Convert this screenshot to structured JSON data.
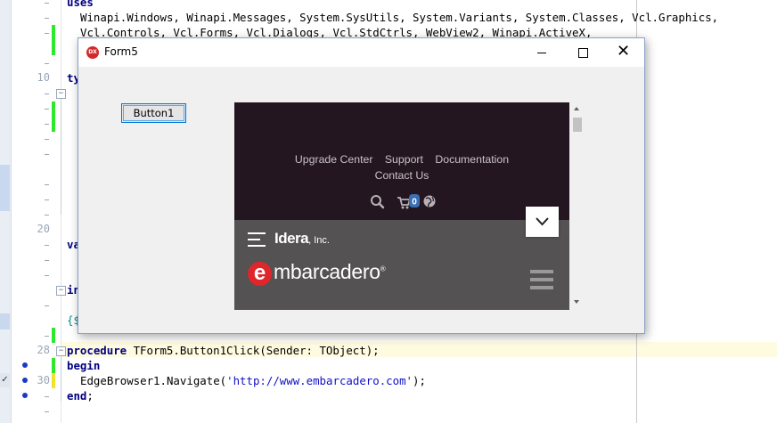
{
  "editor": {
    "line_numbers": [
      {
        "n": "10",
        "row": 5
      },
      {
        "n": "20",
        "row": 15
      },
      {
        "n": "28",
        "row": 23
      },
      {
        "n": "30",
        "row": 25
      }
    ],
    "lines": [
      {
        "row": 0,
        "indent": 0,
        "parts": [
          {
            "t": "uses",
            "c": "kw"
          }
        ]
      },
      {
        "row": 1,
        "indent": 2,
        "parts": [
          {
            "t": "Winapi.Windows, Winapi.Messages, System.SysUtils, System.Variants, System.Classes, Vcl.Graphics,",
            "c": ""
          }
        ]
      },
      {
        "row": 2,
        "indent": 2,
        "parts": [
          {
            "t": "Vcl.Controls, Vcl.Forms, Vcl.Dialogs, Vcl.StdCtrls, WebView2, Winapi.ActiveX,",
            "c": ""
          }
        ]
      },
      {
        "row": 5,
        "indent": 0,
        "parts": [
          {
            "t": "ty",
            "c": "kw"
          }
        ]
      },
      {
        "row": 16,
        "indent": 0,
        "parts": [
          {
            "t": "va",
            "c": "kw"
          }
        ]
      },
      {
        "row": 19,
        "indent": 0,
        "parts": [
          {
            "t": "in",
            "c": "kw"
          }
        ]
      },
      {
        "row": 21,
        "indent": 0,
        "parts": [
          {
            "t": "{$",
            "c": "cm"
          }
        ]
      },
      {
        "row": 23,
        "indent": 0,
        "parts": [
          {
            "t": "procedure",
            "c": "kw"
          },
          {
            "t": " TForm5.Button1Click(Sender: TObject);",
            "c": ""
          }
        ]
      },
      {
        "row": 24,
        "indent": 0,
        "parts": [
          {
            "t": "begin",
            "c": "kw"
          }
        ]
      },
      {
        "row": 25,
        "indent": 2,
        "parts": [
          {
            "t": "EdgeBrowser1.Navigate(",
            "c": ""
          },
          {
            "t": "'http://www.embarcadero.com'",
            "c": "str"
          },
          {
            "t": ");",
            "c": ""
          }
        ]
      },
      {
        "row": 26,
        "indent": 0,
        "parts": [
          {
            "t": "end",
            "c": "kw"
          },
          {
            "t": ";",
            "c": ""
          }
        ]
      }
    ]
  },
  "form": {
    "title": "Form5",
    "app_icon_text": "DX",
    "close_glyph": "✕",
    "button_label": "Button1"
  },
  "webview": {
    "nav_links_row1": [
      "Upgrade Center",
      "Support",
      "Documentation"
    ],
    "nav_links_row2": [
      "Contact Us"
    ],
    "cart_count": "0",
    "idera_brand": "Idera",
    "idera_suffix": ", Inc.",
    "embarcadero_e": "e",
    "embarcadero_rest": "mbarcadero",
    "embarcadero_reg": "®",
    "colors": {
      "top_bg": "#241621",
      "bottom_bg": "#545252",
      "embarcadero_red": "#e0262b",
      "cart_badge": "#3a6fb3"
    },
    "icons": [
      "search-icon",
      "cart-icon",
      "globe-icon",
      "chevron-down-icon",
      "hamburger-icon"
    ]
  }
}
